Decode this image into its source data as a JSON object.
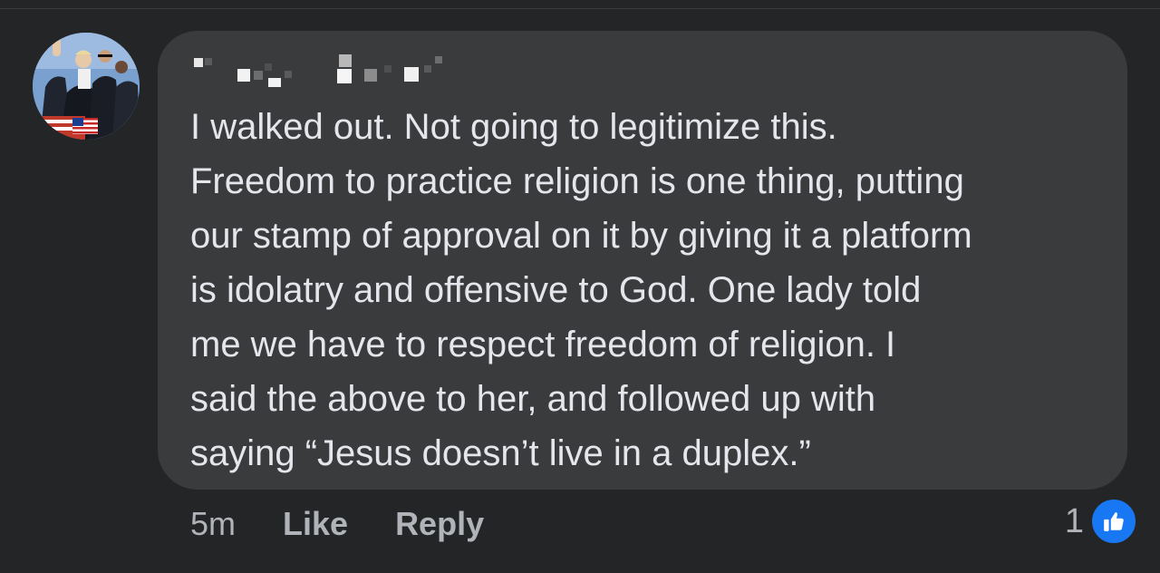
{
  "comment": {
    "lines": [
      "I walked out.  Not going to legitimize this.",
      "Freedom to practice religion is one thing, putting",
      "our stamp of approval on it by giving it a platform",
      "is idolatry and offensive to God. One lady told",
      "me we have to respect freedom of religion.  I",
      "said the above to her, and followed up with",
      "saying “Jesus doesn’t live in a duplex.”"
    ]
  },
  "actions": {
    "time": "5m",
    "like_label": "Like",
    "reply_label": "Reply"
  },
  "reactions": {
    "count": "1",
    "icon": "thumbs-up-icon"
  },
  "colors": {
    "background": "#242526",
    "bubble": "#3a3b3c",
    "text": "#e4e6eb",
    "secondary_text": "#b0b3b8",
    "like_blue": "#1877f2"
  }
}
